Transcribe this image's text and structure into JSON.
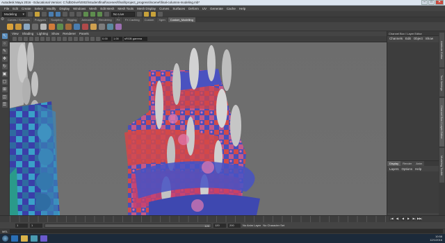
{
  "window": {
    "title": "Autodesk Maya 2016 - Educational Version: C:\\\\dbDrive\\\\0002\\\\studentfinal\\\\scenes\\\\final\\\\project_progress\\\\scene\\\\final-columns-modeling.mb*",
    "min": "–",
    "max": "□",
    "close": "✕"
  },
  "menubar": [
    "File",
    "Edit",
    "Create",
    "Select",
    "Modify",
    "Display",
    "Windows",
    "Mesh",
    "Edit Mesh",
    "Mesh Tools",
    "Mesh Display",
    "Curves",
    "Surfaces",
    "Deform",
    "UV",
    "Generate",
    "Cache",
    "Help"
  ],
  "statusline": {
    "mode": "Modeling",
    "live_surface": "No Live Surface"
  },
  "shelf": {
    "tabs": [
      "Curves / Surfaces",
      "Polygons",
      "Sculpting",
      "Rigging",
      "Animation",
      "Rendering",
      "FX",
      "FX Caching",
      "Custom",
      "Xgen",
      "Custom_Modelling"
    ],
    "active_tab": "Custom_Modelling"
  },
  "panel": {
    "menus": [
      "View",
      "Shading",
      "Lighting",
      "Show",
      "Renderer",
      "Panels"
    ],
    "field1": "0.00",
    "field2": "1.00",
    "colorspace": "sRGB gamma"
  },
  "channel_box": {
    "header": "Channel Box / Layer Editor",
    "menus": [
      "Channels",
      "Edit",
      "Object",
      "Show"
    ],
    "layer_tabs": [
      "Display",
      "Render",
      "Anim"
    ],
    "active_layer_tab": "Display",
    "layer_menus": [
      "Layers",
      "Options",
      "Help"
    ]
  },
  "side_tabs": [
    "Attribute Editor",
    "Tool Settings",
    "Channel Box / Layer Editor",
    "Modeling Toolkit"
  ],
  "timeline": {
    "playback": [
      "|◀",
      "◀|",
      "◀",
      "▶",
      "▶|",
      "▶▶|"
    ]
  },
  "range": {
    "start": "1",
    "slider_start": "1",
    "slider_end": "120",
    "end": "120",
    "anim_end": "200",
    "anim_layer": "No Anim Layer",
    "character": "No Character Set"
  },
  "cmdline": {
    "label": "MEL"
  },
  "taskbar": {
    "time": "10:58",
    "date": "12/1/2016"
  }
}
